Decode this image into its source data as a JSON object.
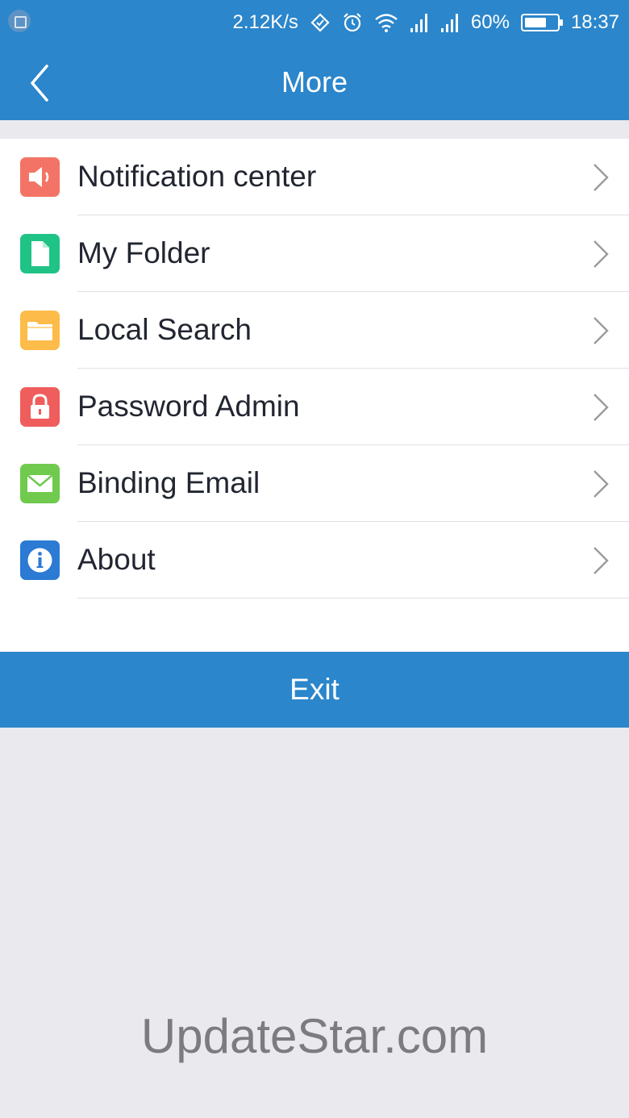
{
  "status_bar": {
    "speed": "2.12K/s",
    "battery_percent": "60%",
    "time": "18:37"
  },
  "header": {
    "title": "More"
  },
  "menu": {
    "items": [
      {
        "label": "Notification center",
        "icon": "speaker-icon",
        "color": "#f37466"
      },
      {
        "label": "My Folder",
        "icon": "document-icon",
        "color": "#20c386"
      },
      {
        "label": "Local Search",
        "icon": "folder-icon",
        "color": "#fdbb4a"
      },
      {
        "label": "Password Admin",
        "icon": "lock-icon",
        "color": "#ef5d5d"
      },
      {
        "label": "Binding Email",
        "icon": "envelope-icon",
        "color": "#6fca4e"
      },
      {
        "label": "About",
        "icon": "info-icon",
        "color": "#2b7ad3"
      }
    ]
  },
  "exit_label": "Exit",
  "watermark": "UpdateStar.com",
  "colors": {
    "primary": "#2b86cb",
    "background": "#e9e9ee"
  }
}
